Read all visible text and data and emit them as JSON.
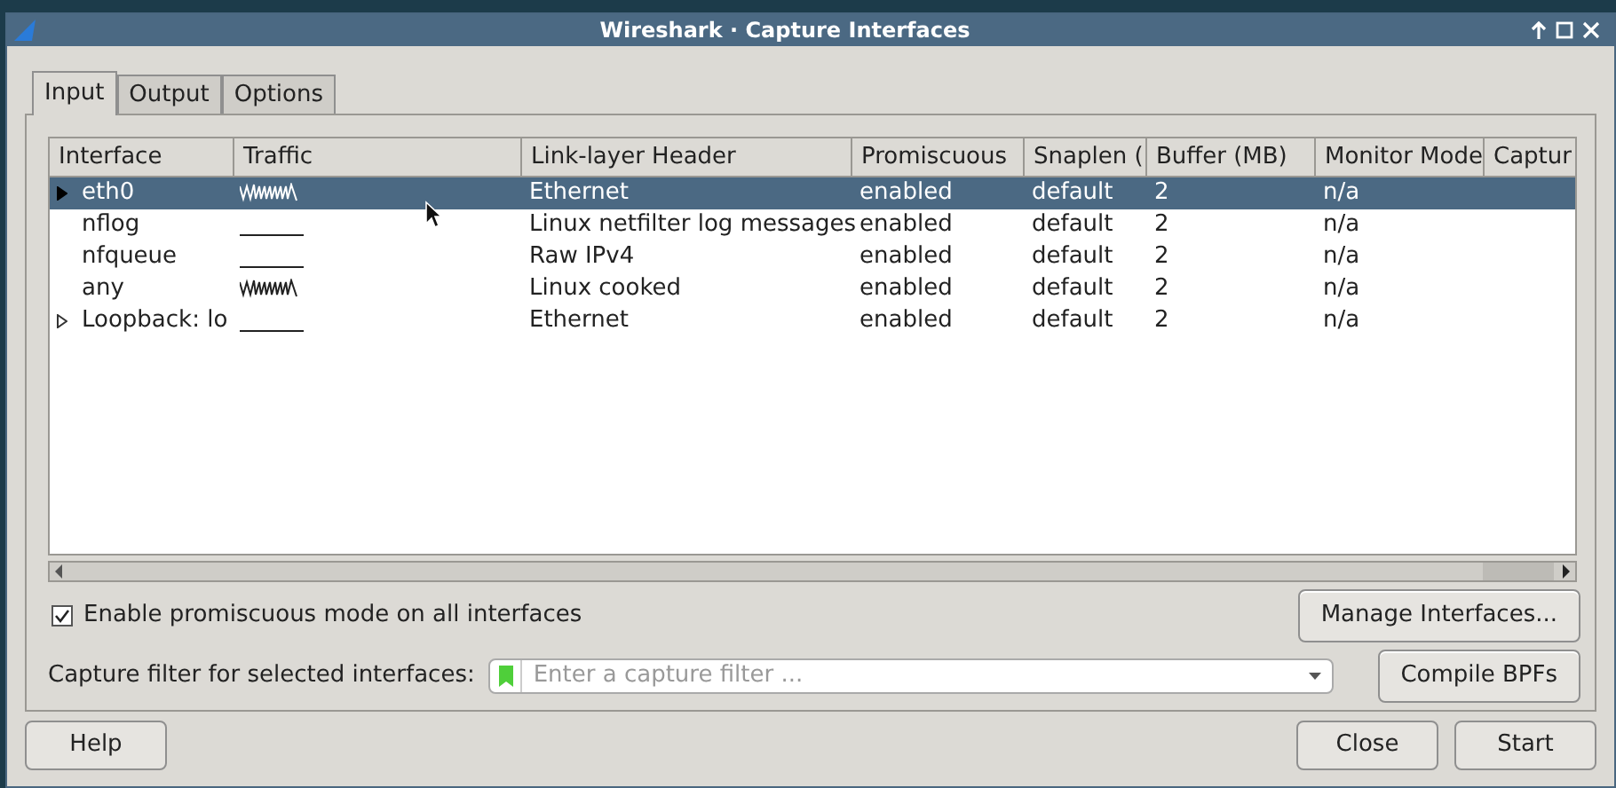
{
  "window": {
    "title": "Wireshark · Capture Interfaces"
  },
  "tabs": [
    {
      "label": "Input",
      "selected": true
    },
    {
      "label": "Output",
      "selected": false
    },
    {
      "label": "Options",
      "selected": false
    }
  ],
  "table": {
    "columns": [
      "Interface",
      "Traffic",
      "Link-layer Header",
      "Promiscuous",
      "Snaplen (",
      "Buffer (MB)",
      "Monitor Mode",
      "Captur"
    ],
    "rows": [
      {
        "interface": "eth0",
        "expandable": true,
        "selected": true,
        "kind": "active",
        "link": "Ethernet",
        "promiscuous": "enabled",
        "snaplen": "default",
        "buffer": "2",
        "monitor": "n/a"
      },
      {
        "interface": "nflog",
        "expandable": false,
        "selected": false,
        "kind": "idle",
        "link": "Linux netfilter log messages",
        "promiscuous": "enabled",
        "snaplen": "default",
        "buffer": "2",
        "monitor": "n/a"
      },
      {
        "interface": "nfqueue",
        "expandable": false,
        "selected": false,
        "kind": "idle",
        "link": "Raw IPv4",
        "promiscuous": "enabled",
        "snaplen": "default",
        "buffer": "2",
        "monitor": "n/a"
      },
      {
        "interface": "any",
        "expandable": false,
        "selected": false,
        "kind": "active",
        "link": "Linux cooked",
        "promiscuous": "enabled",
        "snaplen": "default",
        "buffer": "2",
        "monitor": "n/a"
      },
      {
        "interface": "Loopback: lo",
        "expandable": true,
        "selected": false,
        "kind": "idle",
        "link": "Ethernet",
        "promiscuous": "enabled",
        "snaplen": "default",
        "buffer": "2",
        "monitor": "n/a"
      }
    ]
  },
  "promiscuous_all": {
    "label": "Enable promiscuous mode on all interfaces",
    "checked": true
  },
  "manage_button": "Manage Interfaces...",
  "capture_filter": {
    "label": "Capture filter for selected interfaces:",
    "placeholder": "Enter a capture filter ..."
  },
  "compile_button": "Compile BPFs",
  "footer_buttons": [
    "Help",
    "Close",
    "Start"
  ]
}
